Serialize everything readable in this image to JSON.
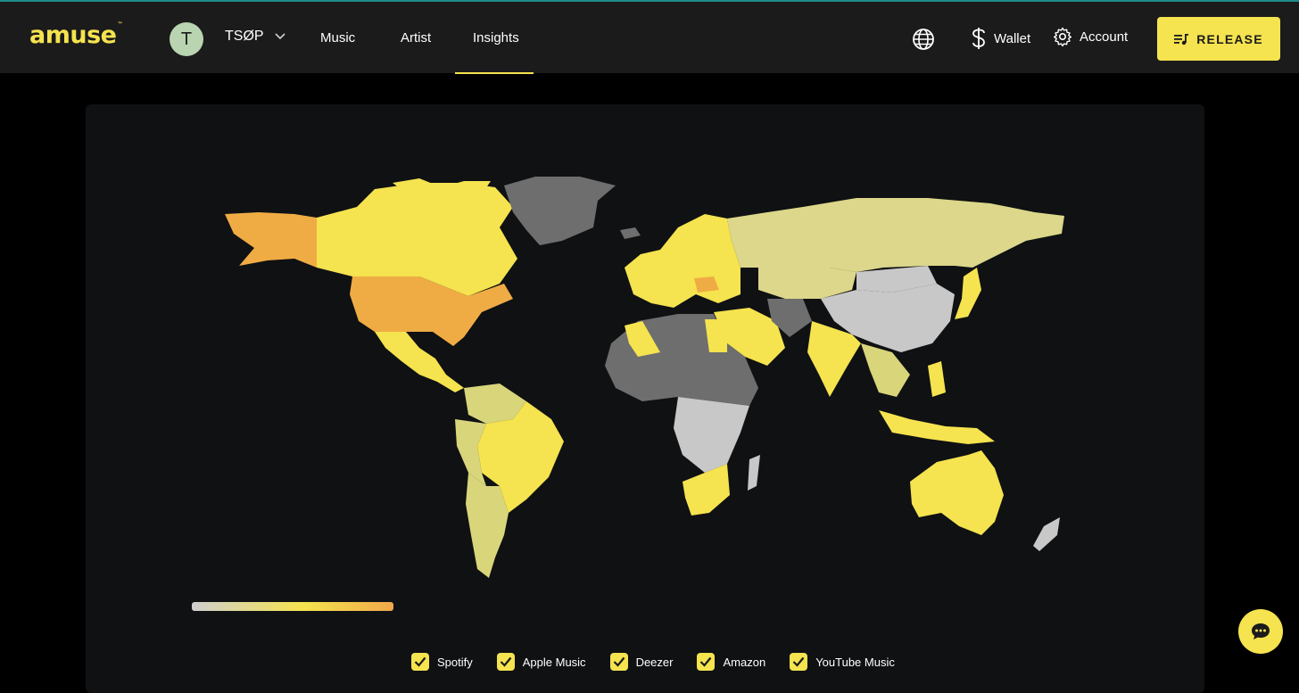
{
  "header": {
    "logo": "amuse",
    "logo_tm": "™",
    "avatar_initial": "T",
    "artist_name": "TSØP",
    "nav": {
      "music": "Music",
      "artist": "Artist",
      "insights": "Insights"
    },
    "wallet_label": "Wallet",
    "account_label": "Account",
    "release_label": "RELEASE"
  },
  "colors": {
    "accent": "#f5e34f",
    "topbar": "#1b1b1b",
    "panel": "#0f1113",
    "map_high": "#f0ac44",
    "map_mid": "#f5e34f",
    "map_low": "#c8c8c8",
    "map_nodata": "#6e6e6e"
  },
  "map": {
    "gradient_stops": [
      "#cfcfcf",
      "#f5e34f",
      "#f0a84a"
    ],
    "regions": [
      {
        "name": "Alaska",
        "level": "high"
      },
      {
        "name": "Canada",
        "level": "mid"
      },
      {
        "name": "Greenland",
        "level": "none"
      },
      {
        "name": "United States",
        "level": "high"
      },
      {
        "name": "Mexico",
        "level": "mid"
      },
      {
        "name": "Brazil",
        "level": "mid"
      },
      {
        "name": "Russia",
        "level": "low-mid"
      },
      {
        "name": "China",
        "level": "low"
      },
      {
        "name": "India",
        "level": "mid"
      },
      {
        "name": "Australia",
        "level": "mid"
      },
      {
        "name": "Romania",
        "level": "high"
      },
      {
        "name": "North Africa",
        "level": "none"
      },
      {
        "name": "South Africa",
        "level": "mid"
      }
    ]
  },
  "legend": {
    "items": [
      {
        "label": "Spotify",
        "checked": true
      },
      {
        "label": "Apple Music",
        "checked": true
      },
      {
        "label": "Deezer",
        "checked": true
      },
      {
        "label": "Amazon",
        "checked": true
      },
      {
        "label": "YouTube Music",
        "checked": true
      }
    ]
  },
  "icons": {
    "chevron": "chevron-down-icon",
    "globe": "globe-icon",
    "wallet": "dollar-icon",
    "account": "gear-icon",
    "release": "playlist-music-icon",
    "chat": "chat-icon",
    "check": "check-icon"
  }
}
